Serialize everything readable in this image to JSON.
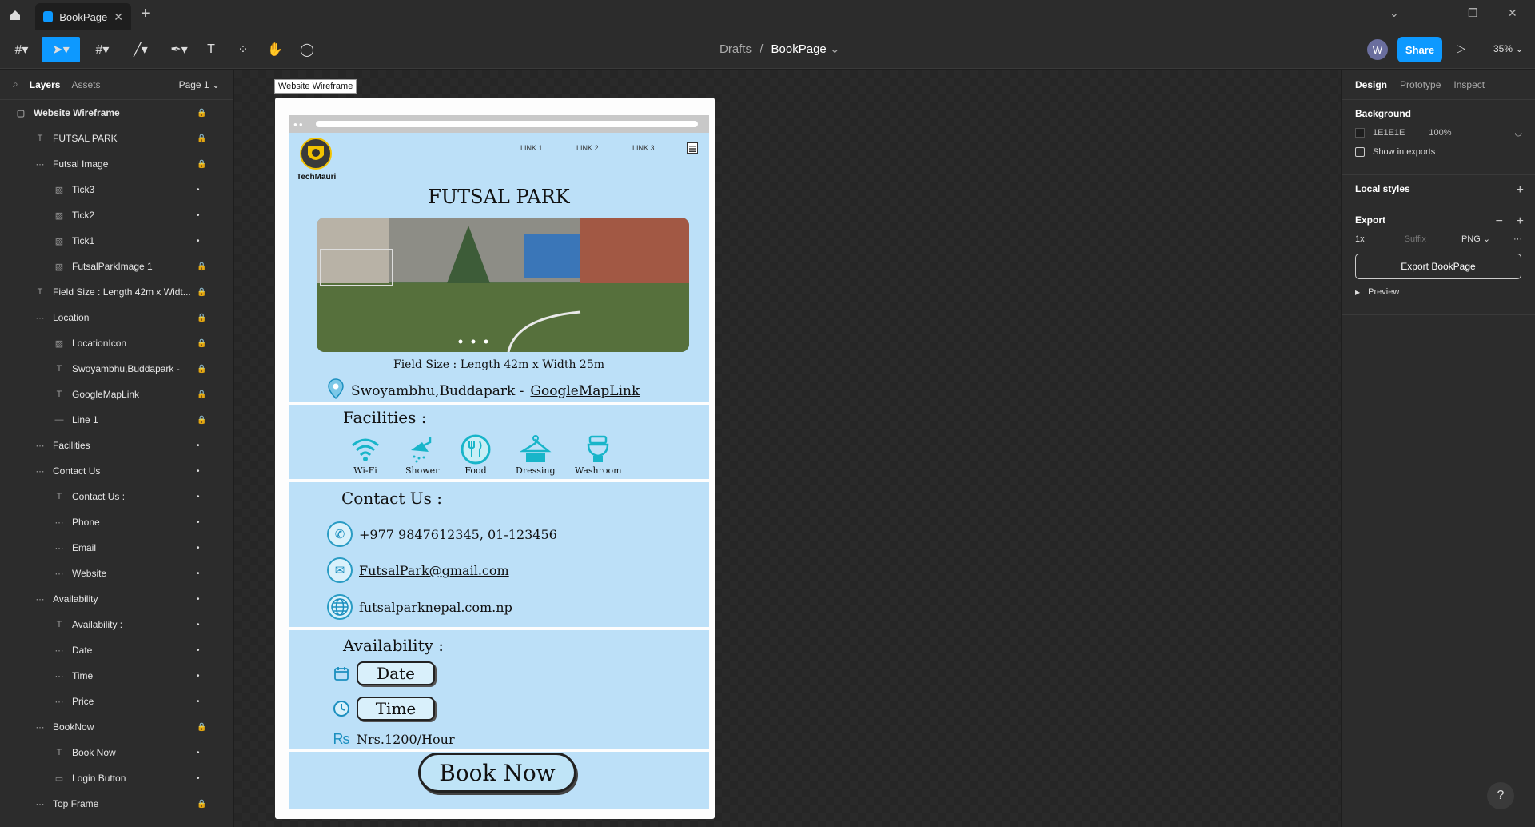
{
  "titlebar": {
    "tab_title": "BookPage",
    "close": "✕",
    "new_tab": "+"
  },
  "toolbar": {
    "crumb_parent": "Drafts",
    "crumb_sep": "/",
    "crumb_current": "BookPage",
    "avatar_letter": "W",
    "share_label": "Share",
    "zoom": "35%"
  },
  "layers_panel": {
    "tab_layers": "Layers",
    "tab_assets": "Assets",
    "page": "Page 1",
    "items": [
      {
        "label": "Website Wireframe",
        "lock": "🔒"
      },
      {
        "label": "FUTSAL PARK",
        "lock": "🔒"
      },
      {
        "label": "Futsal Image",
        "lock": "🔒"
      },
      {
        "label": "Tick3",
        "lock": "•"
      },
      {
        "label": "Tick2",
        "lock": "•"
      },
      {
        "label": "Tick1",
        "lock": "•"
      },
      {
        "label": "FutsalParkImage 1",
        "lock": "🔒"
      },
      {
        "label": "Field Size : Length 42m x Widt...",
        "lock": "🔒"
      },
      {
        "label": "Location",
        "lock": "🔒"
      },
      {
        "label": "LocationIcon",
        "lock": "🔒"
      },
      {
        "label": "Swoyambhu,Buddapark -",
        "lock": "🔒"
      },
      {
        "label": "GoogleMapLink",
        "lock": "🔒"
      },
      {
        "label": "Line 1",
        "lock": "🔒"
      },
      {
        "label": "Facilities",
        "lock": "•"
      },
      {
        "label": "Contact Us",
        "lock": "•"
      },
      {
        "label": "Contact Us :",
        "lock": "•"
      },
      {
        "label": "Phone",
        "lock": "•"
      },
      {
        "label": "Email",
        "lock": "•"
      },
      {
        "label": "Website",
        "lock": "•"
      },
      {
        "label": "Availability",
        "lock": "•"
      },
      {
        "label": "Availability :",
        "lock": "•"
      },
      {
        "label": "Date",
        "lock": "•"
      },
      {
        "label": "Time",
        "lock": "•"
      },
      {
        "label": "Price",
        "lock": "•"
      },
      {
        "label": "BookNow",
        "lock": "🔒"
      },
      {
        "label": "Book Now",
        "lock": "•"
      },
      {
        "label": "Login Button",
        "lock": "•"
      },
      {
        "label": "Top Frame",
        "lock": "🔒"
      }
    ]
  },
  "canvas": {
    "frame_label": "Website Wireframe",
    "site": {
      "logo_text": "TechMauri",
      "links": [
        "LINK 1",
        "LINK 2",
        "LINK 3"
      ],
      "title": "FUTSAL PARK",
      "field_size": "Field Size : Length 42m x Width 25m",
      "location": "Swoyambhu,Buddapark -",
      "map_link": "GoogleMapLink",
      "facilities_heading": "Facilities :",
      "facilities": [
        {
          "label": "Wi-Fi",
          "icon": "wifi-icon"
        },
        {
          "label": "Shower",
          "icon": "shower-icon"
        },
        {
          "label": "Food",
          "icon": "food-icon"
        },
        {
          "label": "Dressing",
          "icon": "dressing-icon"
        },
        {
          "label": "Washroom",
          "icon": "washroom-icon"
        }
      ],
      "contact_heading": "Contact Us :",
      "phone": "+977 9847612345, 01-123456",
      "email": "FutsalPark@gmail.com",
      "website": "futsalparknepal.com.np",
      "availability_heading": "Availability :",
      "date_label": "Date",
      "time_label": "Time",
      "price": "Nrs.1200/Hour",
      "book_now": "Book Now"
    }
  },
  "design_panel": {
    "tab_design": "Design",
    "tab_prototype": "Prototype",
    "tab_inspect": "Inspect",
    "background_heading": "Background",
    "bg_hex": "1E1E1E",
    "bg_opacity": "100%",
    "show_in_exports": "Show in exports",
    "local_styles": "Local styles",
    "export_heading": "Export",
    "export_scale": "1x",
    "export_suffix": "Suffix",
    "export_format": "PNG",
    "export_button": "Export BookPage",
    "preview": "Preview"
  },
  "colors": {
    "accent": "#0d99ff",
    "site_bg": "#bce0f8"
  }
}
